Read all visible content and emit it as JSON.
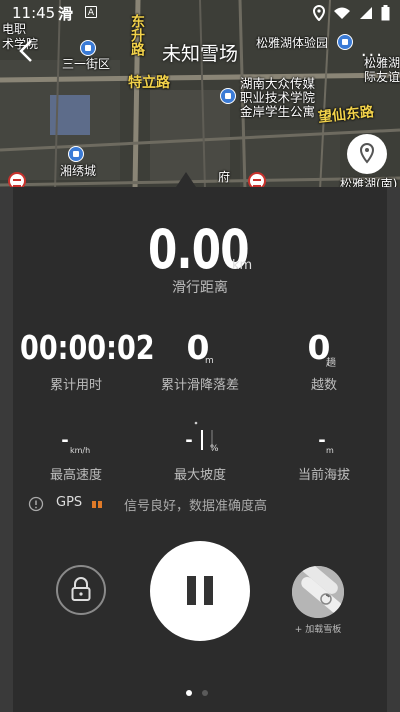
{
  "status_bar": {
    "time": "11:45",
    "app_icon_1": "滑",
    "app_icon_2": "A"
  },
  "header": {
    "title": "未知雪场",
    "more": "..."
  },
  "map_labels": {
    "l1": "电职",
    "l2": "术学院",
    "l3": "三一街区",
    "l4": "东升路",
    "l5": "特立路",
    "l6": "湖南大众传媒",
    "l7": "职业技术学院",
    "l8": "金岸学生公寓",
    "l9": "松雅湖体验园",
    "l10": "松雅湖",
    "l11": "际友谊",
    "l12": "望仙东路",
    "l13": "湘绣城",
    "l14": "府",
    "l15": "松雅湖(南)",
    "l16": "湘"
  },
  "stats": {
    "distance_value": "0.00",
    "distance_unit": "km",
    "distance_label": "滑行距离",
    "time_value": "00:00:02",
    "time_label": "累计用时",
    "drop_value": "0",
    "drop_unit": "m",
    "drop_label": "累计滑降落差",
    "runs_value": "0",
    "runs_unit": "趟",
    "runs_label": "越数",
    "max_speed_value": "-",
    "max_speed_unit": "km/h",
    "max_speed_label": "最高速度",
    "max_slope_value": "-",
    "max_slope_unit": "%",
    "max_slope_label": "最大坡度",
    "altitude_value": "-",
    "altitude_unit": "m",
    "altitude_label": "当前海拔"
  },
  "gps": {
    "label": "GPS",
    "status_text": "信号良好，数据准确度高"
  },
  "controls": {
    "board_label": "+ 加载雪板"
  },
  "pager": {
    "count": 2,
    "active": 0
  }
}
